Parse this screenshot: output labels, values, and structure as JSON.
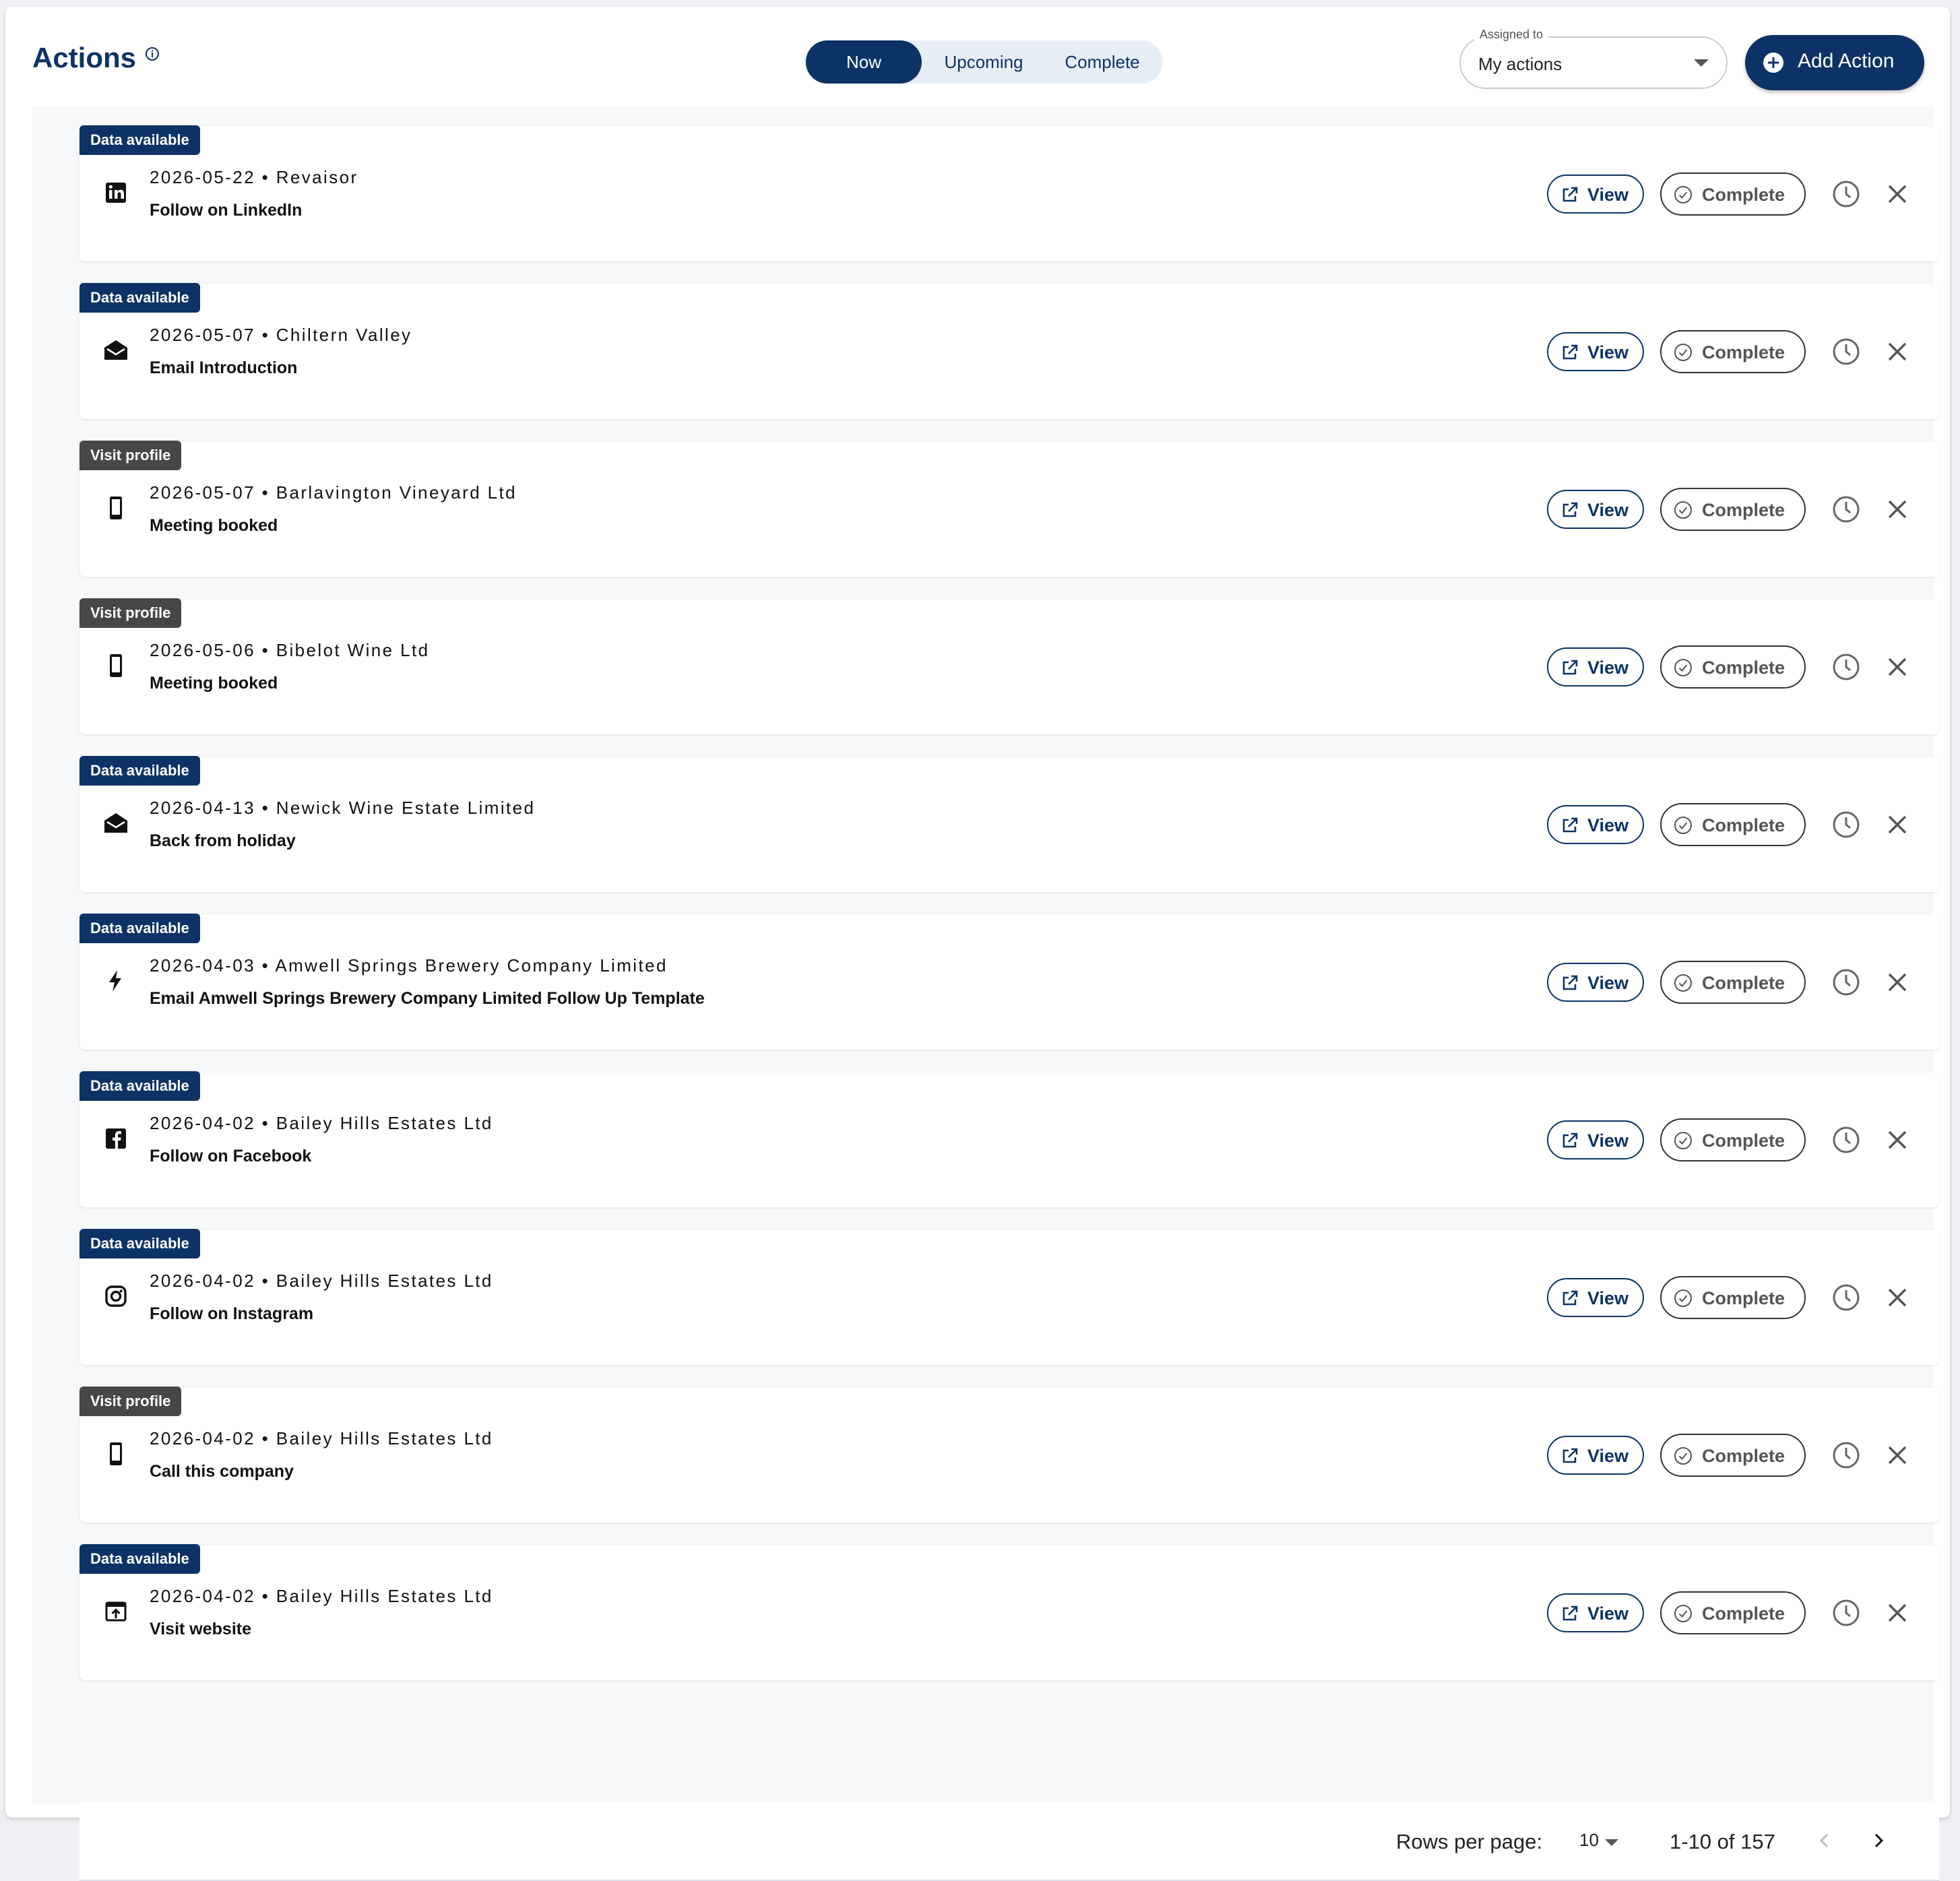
{
  "header": {
    "title": "Actions",
    "tabs": [
      {
        "label": "Now",
        "active": true
      },
      {
        "label": "Upcoming",
        "active": false
      },
      {
        "label": "Complete",
        "active": false
      }
    ],
    "assigned_to": {
      "legend": "Assigned to",
      "value": "My actions"
    },
    "add_action_label": "Add Action"
  },
  "colors": {
    "brand": "#0d3366",
    "badge_data": "#0d3366",
    "badge_visit": "#474747"
  },
  "buttons": {
    "view_label": "View",
    "complete_label": "Complete"
  },
  "actions": [
    {
      "badge": "Data available",
      "badge_type": "data",
      "icon": "linkedin-icon",
      "date": "2026-05-22",
      "company": "Revaisor",
      "title": "Follow on LinkedIn"
    },
    {
      "badge": "Data available",
      "badge_type": "data",
      "icon": "email-icon",
      "date": "2026-05-07",
      "company": "Chiltern Valley",
      "title": "Email Introduction"
    },
    {
      "badge": "Visit profile",
      "badge_type": "visit",
      "icon": "phone-icon",
      "date": "2026-05-07",
      "company": "Barlavington Vineyard Ltd",
      "title": "Meeting booked"
    },
    {
      "badge": "Visit profile",
      "badge_type": "visit",
      "icon": "phone-icon",
      "date": "2026-05-06",
      "company": "Bibelot Wine Ltd",
      "title": "Meeting booked"
    },
    {
      "badge": "Data available",
      "badge_type": "data",
      "icon": "email-icon",
      "date": "2026-04-13",
      "company": "Newick Wine Estate Limited",
      "title": "Back from holiday"
    },
    {
      "badge": "Data available",
      "badge_type": "data",
      "icon": "lightning-icon",
      "date": "2026-04-03",
      "company": "Amwell Springs Brewery Company Limited",
      "title": "Email Amwell Springs Brewery Company Limited Follow Up Template"
    },
    {
      "badge": "Data available",
      "badge_type": "data",
      "icon": "facebook-icon",
      "date": "2026-04-02",
      "company": "Bailey Hills Estates Ltd",
      "title": "Follow on Facebook"
    },
    {
      "badge": "Data available",
      "badge_type": "data",
      "icon": "instagram-icon",
      "date": "2026-04-02",
      "company": "Bailey Hills Estates Ltd",
      "title": "Follow on Instagram"
    },
    {
      "badge": "Visit profile",
      "badge_type": "visit",
      "icon": "phone-icon",
      "date": "2026-04-02",
      "company": "Bailey Hills Estates Ltd",
      "title": "Call this company"
    },
    {
      "badge": "Data available",
      "badge_type": "data",
      "icon": "website-icon",
      "date": "2026-04-02",
      "company": "Bailey Hills Estates Ltd",
      "title": "Visit website"
    }
  ],
  "pagination": {
    "rows_label": "Rows per page:",
    "rows_value": "10",
    "range": "1-10 of 157"
  }
}
